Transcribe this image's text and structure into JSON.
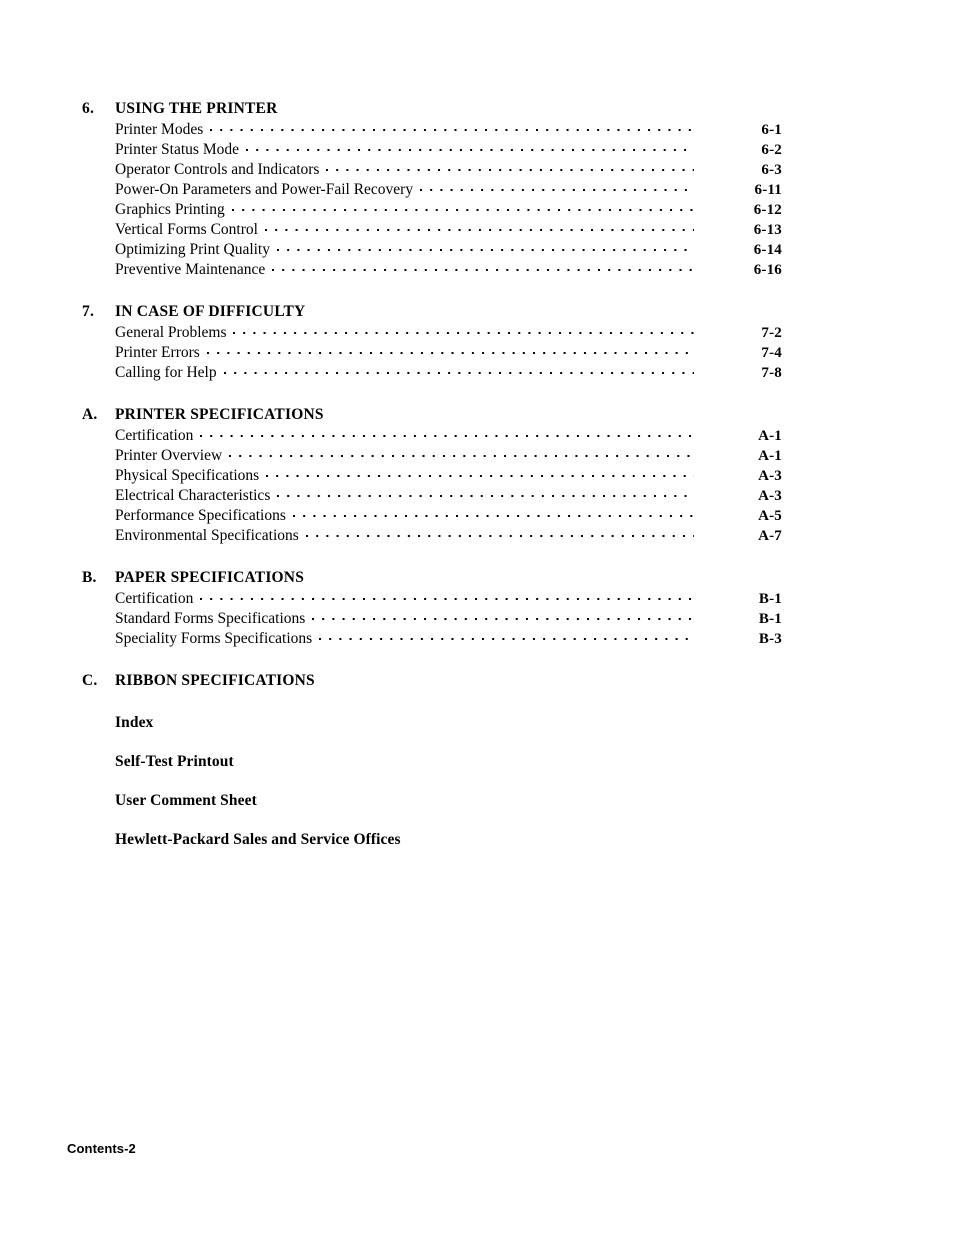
{
  "document": {
    "page_label": "Contents-2"
  },
  "toc": {
    "sections": [
      {
        "number": "6.",
        "title": "USING THE PRINTER",
        "entries": [
          {
            "label": "Printer Modes",
            "page": "6-1"
          },
          {
            "label": "Printer Status Mode",
            "page": "6-2"
          },
          {
            "label": "Operator Controls and Indicators",
            "page": "6-3"
          },
          {
            "label": "Power-On Parameters and Power-Fail Recovery",
            "page": "6-11"
          },
          {
            "label": "Graphics Printing",
            "page": "6-12"
          },
          {
            "label": "Vertical Forms Control",
            "page": "6-13"
          },
          {
            "label": "Optimizing Print Quality",
            "page": "6-14"
          },
          {
            "label": "Preventive Maintenance",
            "page": "6-16"
          }
        ]
      },
      {
        "number": "7.",
        "title": "IN CASE OF DIFFICULTY",
        "entries": [
          {
            "label": "General Problems",
            "page": "7-2"
          },
          {
            "label": "Printer Errors",
            "page": "7-4"
          },
          {
            "label": "Calling for Help",
            "page": "7-8"
          }
        ]
      },
      {
        "number": "A.",
        "title": "PRINTER SPECIFICATIONS",
        "entries": [
          {
            "label": "Certification",
            "page": "A-1"
          },
          {
            "label": "Printer Overview",
            "page": "A-1"
          },
          {
            "label": "Physical Specifications",
            "page": "A-3"
          },
          {
            "label": "Electrical Characteristics",
            "page": "A-3"
          },
          {
            "label": "Performance Specifications",
            "page": "A-5"
          },
          {
            "label": "Environmental Specifications",
            "page": "A-7"
          }
        ]
      },
      {
        "number": "B.",
        "title": "PAPER SPECIFICATIONS",
        "entries": [
          {
            "label": "Certification",
            "page": "B-1"
          },
          {
            "label": "Standard Forms Specifications",
            "page": "B-1"
          },
          {
            "label": "Speciality Forms Specifications",
            "page": "B-3"
          }
        ]
      },
      {
        "number": "C.",
        "title": "RIBBON SPECIFICATIONS",
        "entries": []
      }
    ],
    "back_matter": [
      {
        "label": "Index"
      },
      {
        "label": "Self-Test Printout"
      },
      {
        "label": "User Comment Sheet"
      },
      {
        "label": "Hewlett-Packard Sales and Service Offices"
      }
    ]
  }
}
